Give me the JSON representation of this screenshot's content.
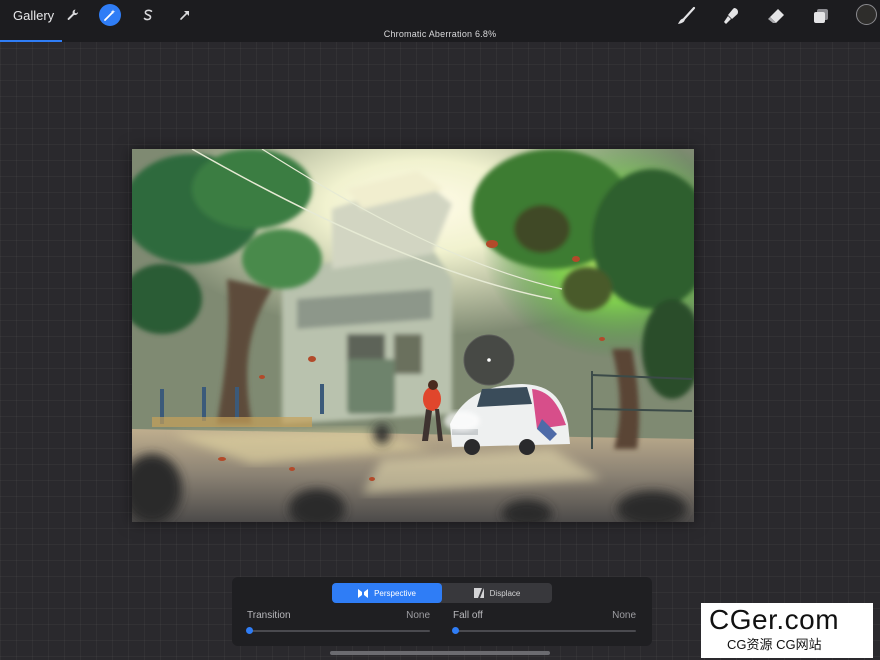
{
  "topbar": {
    "gallery_label": "Gallery",
    "tools_left": [
      {
        "name": "wrench-icon",
        "active": false
      },
      {
        "name": "magic-wand-icon",
        "active": true
      },
      {
        "name": "selection-icon",
        "active": false
      },
      {
        "name": "transform-arrow-icon",
        "active": false
      }
    ],
    "tools_right": [
      {
        "name": "brush-icon"
      },
      {
        "name": "smudge-icon"
      },
      {
        "name": "eraser-icon"
      },
      {
        "name": "layers-icon"
      },
      {
        "name": "color-swatch"
      }
    ],
    "accent_color": "#2f7df6"
  },
  "adjustment": {
    "title": "Chromatic Aberration 6.8%"
  },
  "panel": {
    "modes": [
      {
        "label": "Perspective",
        "icon": "perspective-icon",
        "active": true
      },
      {
        "label": "Displace",
        "icon": "displace-icon",
        "active": false
      }
    ],
    "sliders": [
      {
        "label": "Transition",
        "value": "None",
        "level": 0
      },
      {
        "label": "Fall off",
        "value": "None",
        "level": 0
      }
    ]
  },
  "watermark": {
    "main": "CGer.com",
    "sub": "CG资源 CG网站"
  }
}
